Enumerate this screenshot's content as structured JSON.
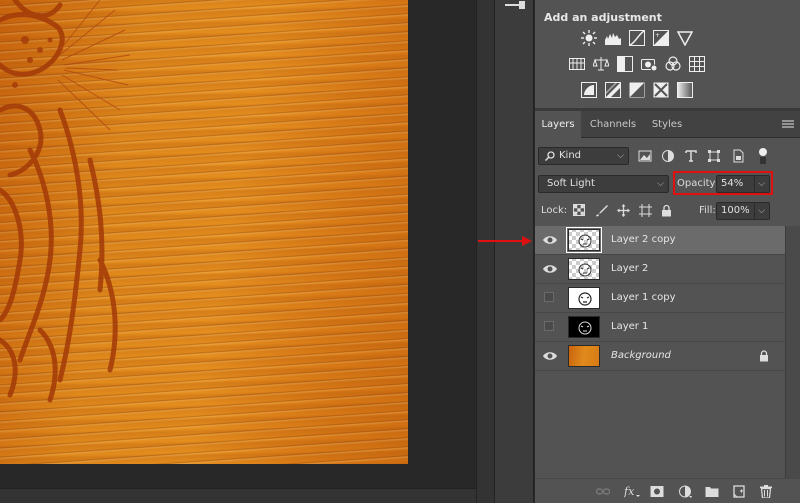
{
  "adjustments": {
    "title": "Add an adjustment",
    "row1": [
      "brightness-contrast-icon",
      "levels-icon",
      "curves-icon",
      "exposure-icon",
      "vibrance-icon"
    ],
    "row2": [
      "hue-saturation-icon",
      "color-balance-icon",
      "black-white-icon",
      "photo-filter-icon",
      "channel-mixer-icon",
      "color-lookup-icon"
    ],
    "row3": [
      "invert-icon",
      "posterize-icon",
      "threshold-icon",
      "selective-color-icon",
      "gradient-map-icon"
    ]
  },
  "tabs": {
    "layers": "Layers",
    "channels": "Channels",
    "styles": "Styles"
  },
  "filter": {
    "kind_label": "Kind"
  },
  "blend": {
    "mode": "Soft Light",
    "opacity_label": "Opacity:",
    "opacity_value": "54%"
  },
  "lock": {
    "label": "Lock:",
    "fill_label": "Fill:",
    "fill_value": "100%"
  },
  "layers": [
    {
      "name": "Layer 2 copy",
      "visible": true,
      "selected": true,
      "thumb": "checker"
    },
    {
      "name": "Layer 2",
      "visible": true,
      "selected": false,
      "thumb": "checker"
    },
    {
      "name": "Layer 1 copy",
      "visible": false,
      "selected": false,
      "thumb": "white"
    },
    {
      "name": "Layer 1",
      "visible": false,
      "selected": false,
      "thumb": "black"
    },
    {
      "name": "Background",
      "visible": true,
      "selected": false,
      "thumb": "wood",
      "locked": true
    }
  ],
  "colors": {
    "highlight_red": "#e01010",
    "panel_bg": "#535353",
    "selected_row": "#6b6b6b"
  }
}
